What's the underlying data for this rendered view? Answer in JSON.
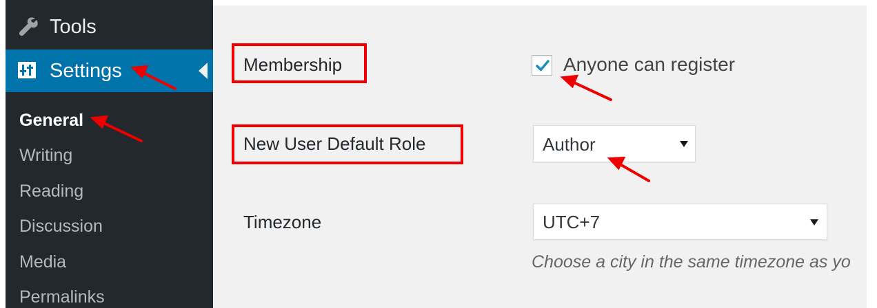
{
  "sidebar": {
    "tools_label": "Tools",
    "tools_icon": "wrench-icon",
    "settings_label": "Settings",
    "settings_icon": "sliders-icon",
    "submenu": [
      {
        "label": "General",
        "current": true
      },
      {
        "label": "Writing"
      },
      {
        "label": "Reading"
      },
      {
        "label": "Discussion"
      },
      {
        "label": "Media"
      },
      {
        "label": "Permalinks"
      }
    ]
  },
  "settings": {
    "membership": {
      "label": "Membership",
      "checkbox_label": "Anyone can register",
      "checked": true
    },
    "default_role": {
      "label": "New User Default Role",
      "selected": "Author"
    },
    "timezone": {
      "label": "Timezone",
      "selected": "UTC+7",
      "hint": "Choose a city in the same timezone as yo"
    }
  },
  "colors": {
    "sidebar_bg": "#23282d",
    "active_menu_bg": "#0073aa",
    "content_bg": "#f1f1f1",
    "annotation_red": "#ee0000",
    "checkmark_blue": "#1e8cbe"
  }
}
